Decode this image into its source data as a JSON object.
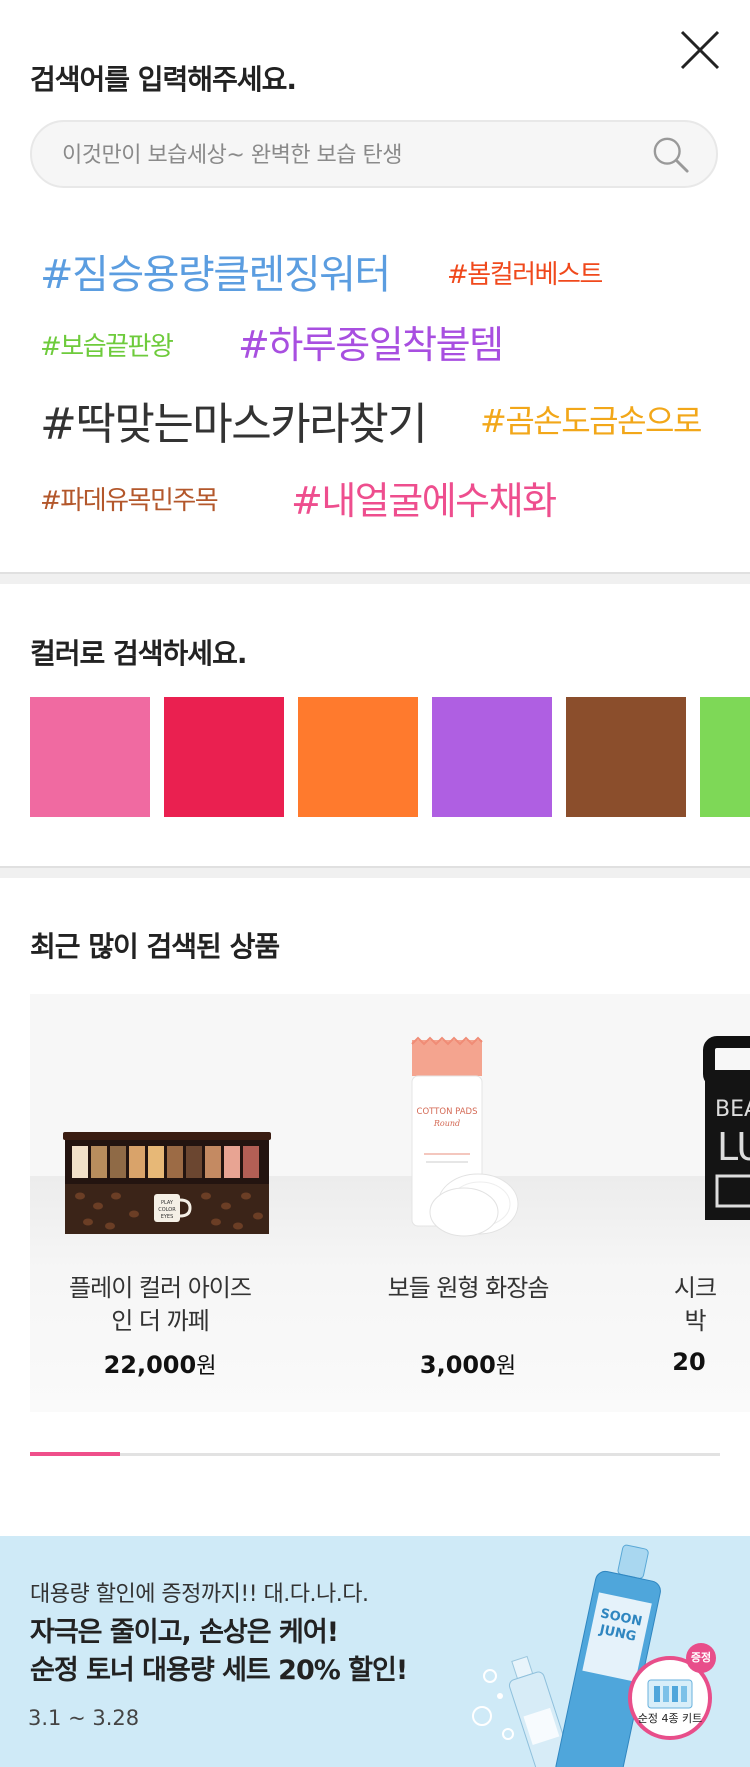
{
  "header": {
    "title": "검색어를 입력해주세요.",
    "close_icon": "close-icon"
  },
  "search": {
    "placeholder": "이것만이 보습세상~ 완벽한 보습 탄생",
    "icon": "search-icon"
  },
  "hashtags": [
    {
      "label": "#짐승용량클렌징워터",
      "color": "#5b9de0"
    },
    {
      "label": "#봄컬러베스트",
      "color": "#f0491c"
    },
    {
      "label": "#보습끝판왕",
      "color": "#6ecb3c"
    },
    {
      "label": "#하루종일착붙템",
      "color": "#a84fe0"
    },
    {
      "label": "#딱맞는마스카라찾기",
      "color": "#333333"
    },
    {
      "label": "#곰손도금손으로",
      "color": "#f2a719"
    },
    {
      "label": "#파데유목민주목",
      "color": "#b3572b"
    },
    {
      "label": "#내얼굴에수채화",
      "color": "#ee4e8e"
    }
  ],
  "color_search": {
    "title": "컬러로 검색하세요.",
    "swatches": [
      "#f06aa1",
      "#ea2050",
      "#ff7a2d",
      "#af5fe2",
      "#8b4e2c",
      "#7ed857"
    ]
  },
  "recent_products": {
    "title": "최근 많이 검색된 상품",
    "items": [
      {
        "name_line1": "플레이 컬러 아이즈",
        "name_line2": "인 더 까페",
        "price": "22,000",
        "currency": "원"
      },
      {
        "name_line1": "보들 원형 화장솜",
        "name_line2": "",
        "price": "3,000",
        "currency": "원"
      },
      {
        "name_line1": "시크",
        "name_line2": "박",
        "price": "20",
        "currency": ""
      }
    ],
    "product2_package_text": [
      "COTTON PADS",
      "Round"
    ],
    "product3_package_text": [
      "BEAUT",
      "LUC"
    ],
    "page_progress": 0.13
  },
  "banner": {
    "subtitle": "대용량 할인에 증정까지!! 대.다.나.다.",
    "title_line1": "자극은 줄이고, 손상은 케어!",
    "title_line2": "순정 토너 대용량 세트 20% 할인!",
    "date": "3.1 ~ 3.28",
    "badge_tag": "증정",
    "badge_label": "순정 4종 키트",
    "bottle_text": [
      "SOON",
      "JUNG"
    ],
    "background": "#cfeaf7"
  }
}
